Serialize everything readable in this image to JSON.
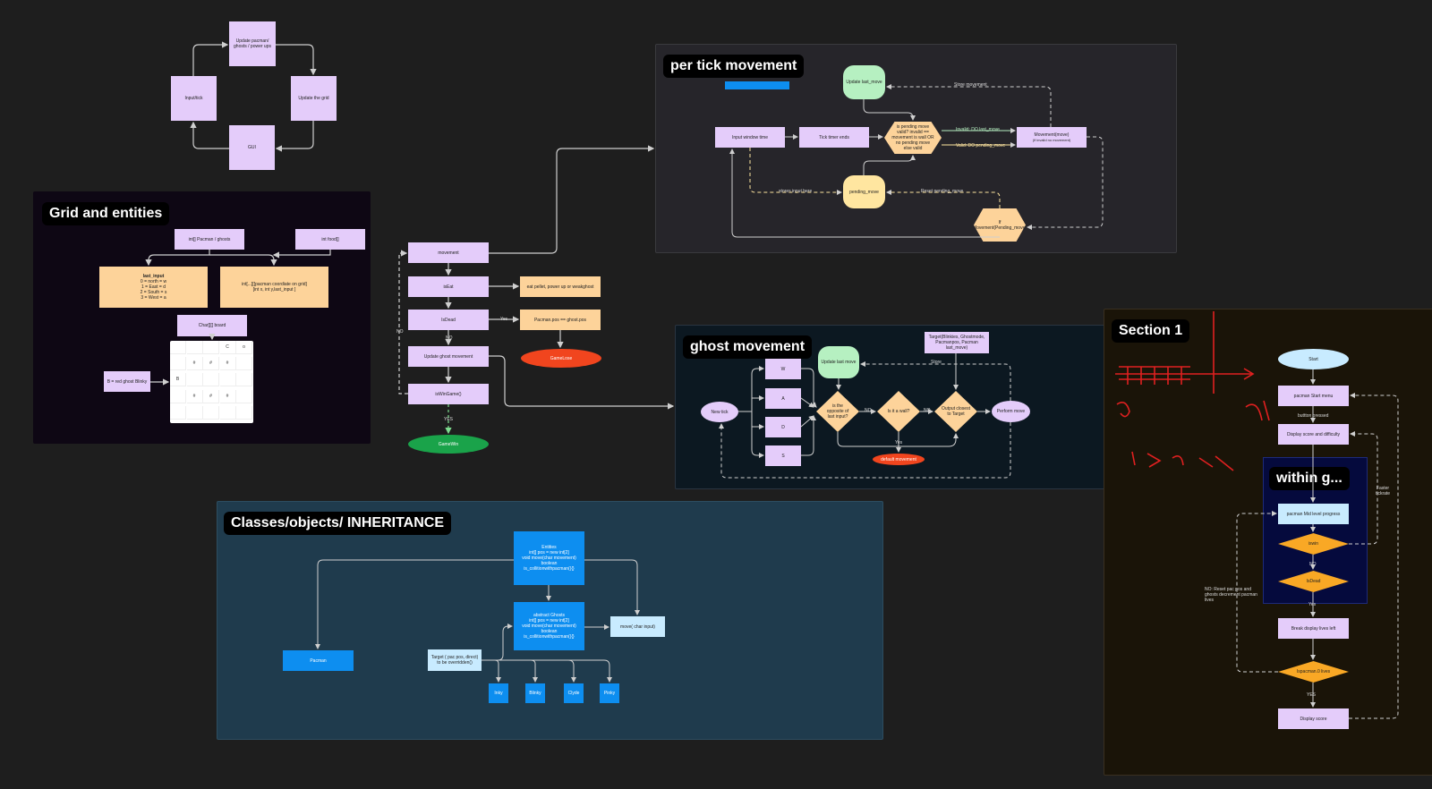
{
  "cycle": {
    "update_pacman": "Update pacman/ ghosts / power ups",
    "input_tick": "Input/tick",
    "update_grid": "Update the grid",
    "gui": "GUI"
  },
  "grid_frame": {
    "title": "Grid and entities",
    "pacman_ghosts": "int[] Pacman / ghosts",
    "int_food": "int food[]",
    "last_input_title": "last_input",
    "last_input_lines": "0 = north = w\n1 = East = d\n2 = South = s\n3 = West = a",
    "coords_line1": "int[...][]pacman coordiate on grid]",
    "coords_line2": "[int x, int y,last_input ]",
    "char_board": "Char[][] board",
    "blinky_note": "B = red ghost Blinky",
    "board_rows": [
      [
        "",
        "",
        "",
        "C",
        "o"
      ],
      [
        "",
        "#",
        "#",
        "#",
        ""
      ],
      [
        "B",
        "",
        "",
        "",
        ""
      ],
      [
        "",
        "#",
        "#",
        "#",
        ""
      ],
      [
        "",
        "",
        "",
        "",
        ""
      ]
    ]
  },
  "main_flow": {
    "movement": "movement",
    "is_eat": "isEat",
    "eat_result": "eat pellet, power up or weakghost",
    "is_dead": "IsDead",
    "yes": "Yes",
    "pac_ghost": "Pacman.pos == ghost.pos",
    "game_lose": "GameLose",
    "no": "NO",
    "update_ghost": "Update ghost movement",
    "is_win": "isWinGame()",
    "no_left": "NO",
    "yes_bottom": "YES",
    "game_win": "GameWin"
  },
  "tick_frame": {
    "title": "per tick movement",
    "update_last_move": "Update last_move",
    "store_movement": "Store movement",
    "input_window": "Input window time",
    "tick_timer": "Tick timer ends",
    "pending_valid": "is pending move valid? invalid == movement is wall OR no pending move else valid",
    "invalid": "Invalid: DO last_move",
    "valid": "Valid: DO pending_move",
    "movement_move": "Movement(move)",
    "movement_sub": "(if invalid no movement)",
    "stores_input": "stores input here",
    "pending_move": "pending_move",
    "reset_pending": "Reset pending_move",
    "if_movement": "If Movement(Pending_move)"
  },
  "ghost_frame": {
    "title": "ghost movement",
    "update_last_move": "Update last move",
    "targets": "Target(Blinkies, Ghostmode, Pacmanpos, Pacman last_move)",
    "store": "Store",
    "w": "W",
    "a": "A",
    "d": "D",
    "s": "S",
    "new_tick": "New tick",
    "is_opposite": "is the opposite of last input?",
    "no1": "NO",
    "is_wall": "Is it a wall?",
    "no2": "NO",
    "output": "Output closest to Target",
    "perform": "Perform move",
    "yes": "Yes",
    "default_red": "default movement"
  },
  "section_frame": {
    "title": "Section 1",
    "within": "within g...",
    "start": "Start",
    "start_menu": "pacman Start menu",
    "button_pressed": "buttton pressed",
    "display_score": "Display score and difficulty",
    "faster": "Faster tickrate",
    "mid_level": "pacman Mid level progress",
    "is_win": "iswin",
    "no": "NO",
    "is_dead": "IsDead",
    "reset_note": "NO: Reset pac pos and ghosts decrement pacman lives",
    "yes": "Yes",
    "break_display": "Break display lives left",
    "lives": "Ispacman.0 lives",
    "yes2": "YES",
    "display_final": "Display score"
  },
  "classes_frame": {
    "title": "Classes/objects/ INHERITANCE",
    "entities": "Entities\nint[] pos = new int[2]\nvoid move(char movement)\nboolean\nis_collitionwithpacman(){}",
    "abstract_ghosts": "abstract Ghosts\nint[] pos = new int[2]\nvoid move(char movement)\nboolean\nis_collitionwithpacman(){}",
    "move_input": "move( char input)",
    "pacman": "Pacman",
    "target_note": "Target ( pac pos, direct) to be overridden()",
    "inky": "Inky",
    "blinky": "Blinky",
    "clyde": "Clyde",
    "pinky": "Pinky"
  },
  "colors": {
    "purple": "#e4ccfa",
    "orange": "#fdd39a",
    "green": "#b6f0c1",
    "red": "#f1451e",
    "blue": "#0d8ef0"
  }
}
